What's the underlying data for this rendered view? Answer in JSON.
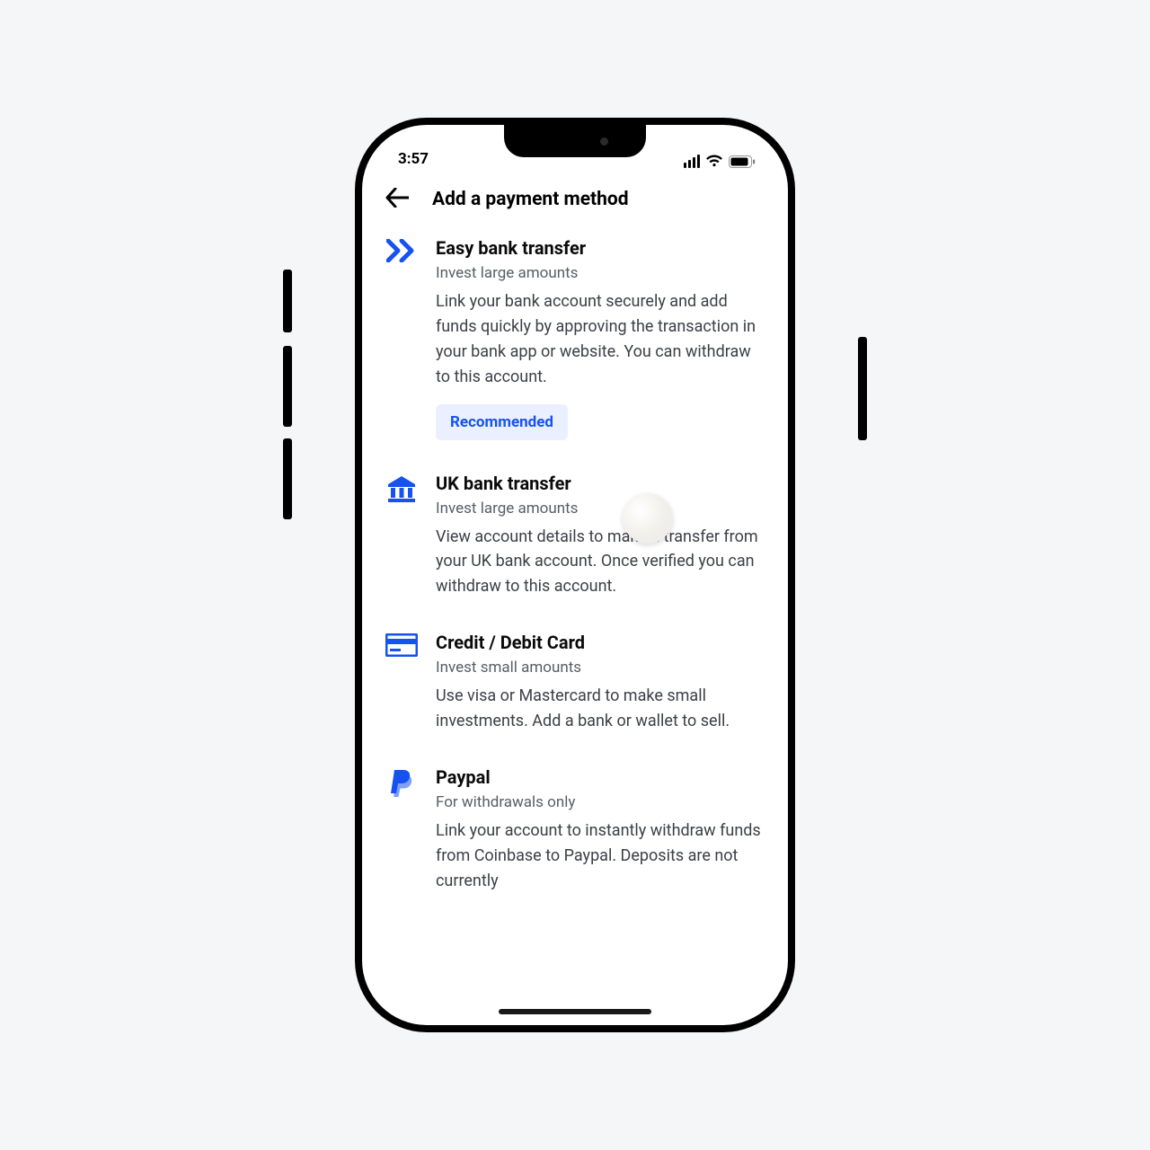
{
  "status": {
    "time": "3:57"
  },
  "header": {
    "title": "Add a payment method"
  },
  "methods": [
    {
      "id": "easy-bank",
      "icon": "double-chevron-icon",
      "title": "Easy bank transfer",
      "subtitle": "Invest large amounts",
      "description": "Link your bank account securely and add funds quickly by approving the transaction in your bank app or website. You can withdraw to this account.",
      "badge": "Recommended"
    },
    {
      "id": "uk-bank",
      "icon": "bank-icon",
      "title": "UK bank transfer",
      "subtitle": "Invest large amounts",
      "description": "View account details to make a transfer from your UK bank account. Once verified you can withdraw to this account."
    },
    {
      "id": "card",
      "icon": "card-icon",
      "title": "Credit / Debit Card",
      "subtitle": "Invest small amounts",
      "description": "Use visa or Mastercard to make small investments. Add a bank or wallet to sell."
    },
    {
      "id": "paypal",
      "icon": "paypal-icon",
      "title": "Paypal",
      "subtitle": "For withdrawals only",
      "description": "Link your account to instantly withdraw funds from Coinbase to Paypal. Deposits are not currently"
    }
  ],
  "colors": {
    "accent": "#1652F0"
  }
}
